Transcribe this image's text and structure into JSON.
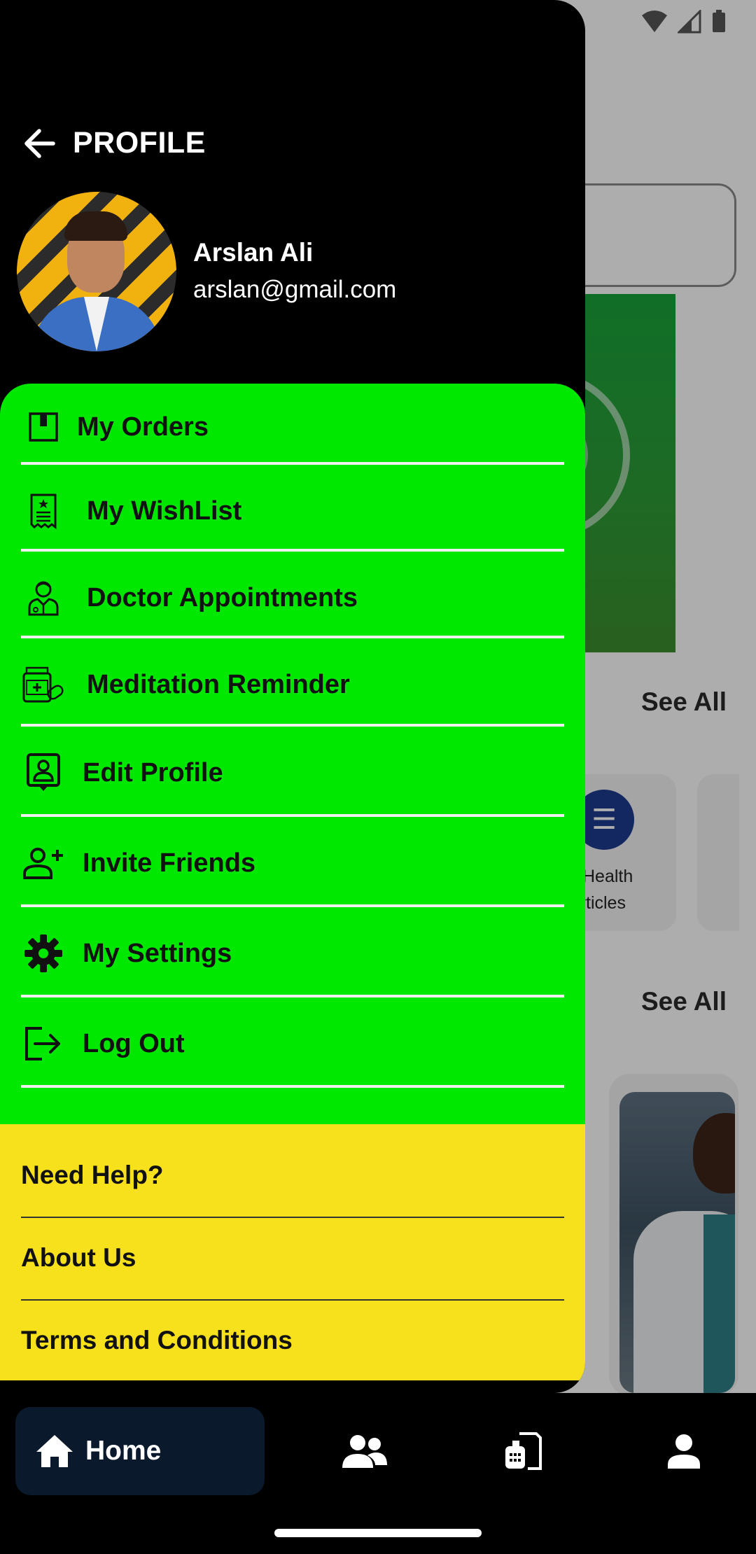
{
  "drawer": {
    "title": "PROFILE",
    "back_icon": "arrow-left-icon"
  },
  "user": {
    "name": "Arslan Ali",
    "email": "arslan@gmail.com"
  },
  "menu": {
    "items": [
      {
        "label": "My Orders",
        "icon": "package-icon"
      },
      {
        "label": "My WishList",
        "icon": "wishlist-icon"
      },
      {
        "label": "Doctor Appointments",
        "icon": "doctor-icon"
      },
      {
        "label": "Meditation Reminder",
        "icon": "medicine-icon"
      },
      {
        "label": "Edit Profile",
        "icon": "profile-card-icon"
      },
      {
        "label": "Invite Friends",
        "icon": "add-user-icon"
      },
      {
        "label": "My Settings",
        "icon": "gear-icon"
      },
      {
        "label": "Log Out",
        "icon": "logout-icon"
      }
    ]
  },
  "help_links": [
    {
      "label": "Need Help?"
    },
    {
      "label": "About Us"
    },
    {
      "label": "Terms and Conditions"
    }
  ],
  "background": {
    "see_all_1": "See All",
    "see_all_2": "See All",
    "card_label_line1": "Health",
    "card_label_line2": "Articles"
  },
  "bottom_nav": {
    "home_label": "Home",
    "items": [
      "home-icon",
      "users-icon",
      "pharmacy-icon",
      "user-icon"
    ]
  },
  "colors": {
    "menu_panel": "#00e800",
    "help_panel": "#f7e11c",
    "nav_active": "#0a1a2c"
  }
}
